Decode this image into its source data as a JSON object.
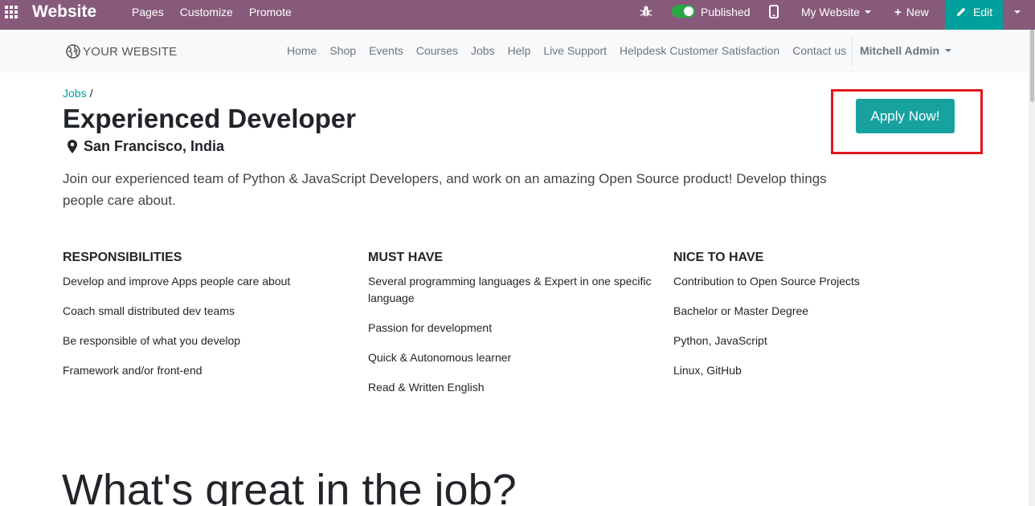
{
  "admin_bar": {
    "app_name": "Website",
    "menu": [
      "Pages",
      "Customize",
      "Promote"
    ],
    "published_label": "Published",
    "published": true,
    "website_selector": "My Website",
    "new_label": "New",
    "edit_label": "Edit",
    "bar_color": "#875a7b",
    "edit_color": "#00a09d",
    "icons": [
      "apps-grid-icon",
      "bug-icon",
      "mobile-preview-icon",
      "pencil-icon"
    ]
  },
  "site_header": {
    "logo_text": "YOUR WEBSITE",
    "nav": [
      "Home",
      "Shop",
      "Events",
      "Courses",
      "Jobs",
      "Help",
      "Live Support",
      "Helpdesk Customer Satisfaction",
      "Contact us"
    ],
    "user": "Mitchell Admin"
  },
  "job": {
    "breadcrumb_link": "Jobs",
    "breadcrumb_sep": "/",
    "title": "Experienced Developer",
    "location": "San Francisco, India",
    "description": "Join our experienced team of Python & JavaScript Developers, and work on an amazing Open Source product! Develop things people care about.",
    "apply_label": "Apply Now!",
    "apply_color": "#17a2a0",
    "highlight_color": "#e2161d"
  },
  "sections": {
    "responsibilities": {
      "title": "RESPONSIBILITIES",
      "items": [
        "Develop and improve Apps people care about",
        "Coach small distributed dev teams",
        "Be responsible of what you develop",
        "Framework and/or front-end"
      ]
    },
    "must_have": {
      "title": "MUST HAVE",
      "items": [
        "Several programming languages & Expert in one specific language",
        "Passion for development",
        "Quick & Autonomous learner",
        "Read & Written English"
      ]
    },
    "nice_to_have": {
      "title": "NICE TO HAVE",
      "items": [
        "Contribution to Open Source Projects",
        "Bachelor or Master Degree",
        "Python, JavaScript",
        "Linux, GitHub"
      ]
    }
  },
  "great_heading": "What's great in the job?"
}
